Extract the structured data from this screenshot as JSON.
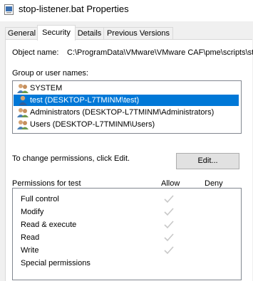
{
  "window": {
    "title": "stop-listener.bat Properties"
  },
  "tabs": [
    {
      "label": "General",
      "active": false
    },
    {
      "label": "Security",
      "active": true
    },
    {
      "label": "Details",
      "active": false
    },
    {
      "label": "Previous Versions",
      "active": false
    }
  ],
  "security": {
    "object_name_label": "Object name:",
    "object_name_value": "C:\\ProgramData\\VMware\\VMware CAF\\pme\\scripts\\stop-listener.bat",
    "group_label": "Group or user names:",
    "users": [
      {
        "name": "SYSTEM",
        "icon": "group-users-icon",
        "selected": false
      },
      {
        "name": "test (DESKTOP-L7TMINM\\test)",
        "icon": "user-icon",
        "selected": true
      },
      {
        "name": "Administrators (DESKTOP-L7TMINM\\Administrators)",
        "icon": "group-users-icon",
        "selected": false
      },
      {
        "name": "Users (DESKTOP-L7TMINM\\Users)",
        "icon": "group-users-icon",
        "selected": false
      }
    ],
    "change_text": "To change permissions, click Edit.",
    "edit_label": "Edit...",
    "permissions_for": "Permissions for test",
    "allow_header": "Allow",
    "deny_header": "Deny",
    "permissions": [
      {
        "name": "Full control",
        "allow": true,
        "deny": false
      },
      {
        "name": "Modify",
        "allow": true,
        "deny": false
      },
      {
        "name": "Read & execute",
        "allow": true,
        "deny": false
      },
      {
        "name": "Read",
        "allow": true,
        "deny": false
      },
      {
        "name": "Write",
        "allow": true,
        "deny": false
      },
      {
        "name": "Special permissions",
        "allow": false,
        "deny": false
      }
    ]
  },
  "colors": {
    "selection": "#0078d7",
    "check": "#c8c8c8"
  }
}
